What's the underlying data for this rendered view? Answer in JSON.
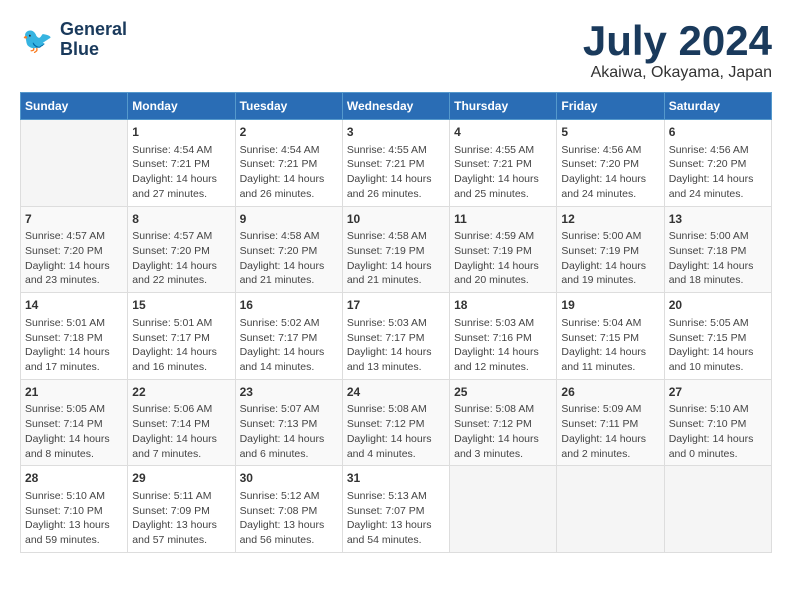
{
  "header": {
    "logo_line1": "General",
    "logo_line2": "Blue",
    "title": "July 2024",
    "location": "Akaiwa, Okayama, Japan"
  },
  "weekdays": [
    "Sunday",
    "Monday",
    "Tuesday",
    "Wednesday",
    "Thursday",
    "Friday",
    "Saturday"
  ],
  "weeks": [
    [
      {
        "day": "",
        "info": ""
      },
      {
        "day": "1",
        "info": "Sunrise: 4:54 AM\nSunset: 7:21 PM\nDaylight: 14 hours\nand 27 minutes."
      },
      {
        "day": "2",
        "info": "Sunrise: 4:54 AM\nSunset: 7:21 PM\nDaylight: 14 hours\nand 26 minutes."
      },
      {
        "day": "3",
        "info": "Sunrise: 4:55 AM\nSunset: 7:21 PM\nDaylight: 14 hours\nand 26 minutes."
      },
      {
        "day": "4",
        "info": "Sunrise: 4:55 AM\nSunset: 7:21 PM\nDaylight: 14 hours\nand 25 minutes."
      },
      {
        "day": "5",
        "info": "Sunrise: 4:56 AM\nSunset: 7:20 PM\nDaylight: 14 hours\nand 24 minutes."
      },
      {
        "day": "6",
        "info": "Sunrise: 4:56 AM\nSunset: 7:20 PM\nDaylight: 14 hours\nand 24 minutes."
      }
    ],
    [
      {
        "day": "7",
        "info": "Sunrise: 4:57 AM\nSunset: 7:20 PM\nDaylight: 14 hours\nand 23 minutes."
      },
      {
        "day": "8",
        "info": "Sunrise: 4:57 AM\nSunset: 7:20 PM\nDaylight: 14 hours\nand 22 minutes."
      },
      {
        "day": "9",
        "info": "Sunrise: 4:58 AM\nSunset: 7:20 PM\nDaylight: 14 hours\nand 21 minutes."
      },
      {
        "day": "10",
        "info": "Sunrise: 4:58 AM\nSunset: 7:19 PM\nDaylight: 14 hours\nand 21 minutes."
      },
      {
        "day": "11",
        "info": "Sunrise: 4:59 AM\nSunset: 7:19 PM\nDaylight: 14 hours\nand 20 minutes."
      },
      {
        "day": "12",
        "info": "Sunrise: 5:00 AM\nSunset: 7:19 PM\nDaylight: 14 hours\nand 19 minutes."
      },
      {
        "day": "13",
        "info": "Sunrise: 5:00 AM\nSunset: 7:18 PM\nDaylight: 14 hours\nand 18 minutes."
      }
    ],
    [
      {
        "day": "14",
        "info": "Sunrise: 5:01 AM\nSunset: 7:18 PM\nDaylight: 14 hours\nand 17 minutes."
      },
      {
        "day": "15",
        "info": "Sunrise: 5:01 AM\nSunset: 7:17 PM\nDaylight: 14 hours\nand 16 minutes."
      },
      {
        "day": "16",
        "info": "Sunrise: 5:02 AM\nSunset: 7:17 PM\nDaylight: 14 hours\nand 14 minutes."
      },
      {
        "day": "17",
        "info": "Sunrise: 5:03 AM\nSunset: 7:17 PM\nDaylight: 14 hours\nand 13 minutes."
      },
      {
        "day": "18",
        "info": "Sunrise: 5:03 AM\nSunset: 7:16 PM\nDaylight: 14 hours\nand 12 minutes."
      },
      {
        "day": "19",
        "info": "Sunrise: 5:04 AM\nSunset: 7:15 PM\nDaylight: 14 hours\nand 11 minutes."
      },
      {
        "day": "20",
        "info": "Sunrise: 5:05 AM\nSunset: 7:15 PM\nDaylight: 14 hours\nand 10 minutes."
      }
    ],
    [
      {
        "day": "21",
        "info": "Sunrise: 5:05 AM\nSunset: 7:14 PM\nDaylight: 14 hours\nand 8 minutes."
      },
      {
        "day": "22",
        "info": "Sunrise: 5:06 AM\nSunset: 7:14 PM\nDaylight: 14 hours\nand 7 minutes."
      },
      {
        "day": "23",
        "info": "Sunrise: 5:07 AM\nSunset: 7:13 PM\nDaylight: 14 hours\nand 6 minutes."
      },
      {
        "day": "24",
        "info": "Sunrise: 5:08 AM\nSunset: 7:12 PM\nDaylight: 14 hours\nand 4 minutes."
      },
      {
        "day": "25",
        "info": "Sunrise: 5:08 AM\nSunset: 7:12 PM\nDaylight: 14 hours\nand 3 minutes."
      },
      {
        "day": "26",
        "info": "Sunrise: 5:09 AM\nSunset: 7:11 PM\nDaylight: 14 hours\nand 2 minutes."
      },
      {
        "day": "27",
        "info": "Sunrise: 5:10 AM\nSunset: 7:10 PM\nDaylight: 14 hours\nand 0 minutes."
      }
    ],
    [
      {
        "day": "28",
        "info": "Sunrise: 5:10 AM\nSunset: 7:10 PM\nDaylight: 13 hours\nand 59 minutes."
      },
      {
        "day": "29",
        "info": "Sunrise: 5:11 AM\nSunset: 7:09 PM\nDaylight: 13 hours\nand 57 minutes."
      },
      {
        "day": "30",
        "info": "Sunrise: 5:12 AM\nSunset: 7:08 PM\nDaylight: 13 hours\nand 56 minutes."
      },
      {
        "day": "31",
        "info": "Sunrise: 5:13 AM\nSunset: 7:07 PM\nDaylight: 13 hours\nand 54 minutes."
      },
      {
        "day": "",
        "info": ""
      },
      {
        "day": "",
        "info": ""
      },
      {
        "day": "",
        "info": ""
      }
    ]
  ]
}
